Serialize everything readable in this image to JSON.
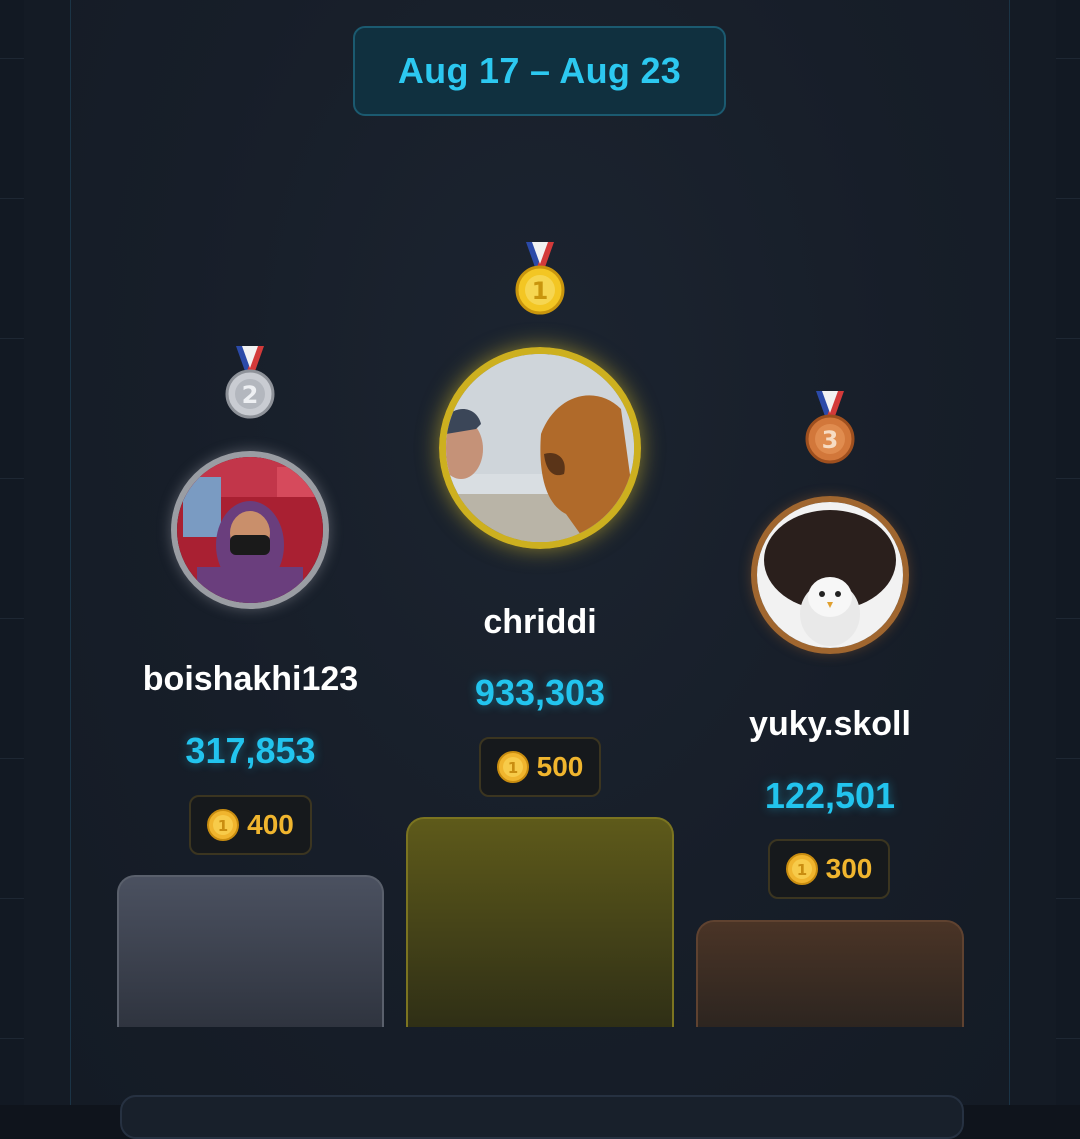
{
  "header": {
    "date_range": "Aug 17 – Aug 23"
  },
  "podium": [
    {
      "rank": 2,
      "medal_icon": "silver-medal-icon",
      "username": "boishakhi123",
      "score": "317,853",
      "reward": "400"
    },
    {
      "rank": 1,
      "medal_icon": "gold-medal-icon",
      "username": "chriddi",
      "score": "933,303",
      "reward": "500"
    },
    {
      "rank": 3,
      "medal_icon": "bronze-medal-icon",
      "username": "yuky.skoll",
      "score": "122,501",
      "reward": "300"
    }
  ],
  "colors": {
    "accent": "#22c4ee",
    "gold": "#d9b920",
    "silver": "#9a9da3",
    "bronze": "#a0662f",
    "coin": "#f0b52e"
  }
}
